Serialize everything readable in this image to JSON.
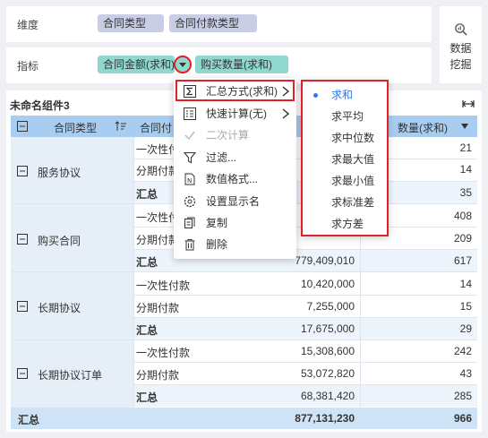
{
  "dimension_row": {
    "label": "维度",
    "chips": [
      "合同类型",
      "合同付款类型"
    ]
  },
  "indicator_row": {
    "label": "指标",
    "chips": [
      "合同金额(求和)",
      "购买数量(求和)"
    ]
  },
  "mining": {
    "label_line1": "数据",
    "label_line2": "挖掘",
    "icon": "data-mining-icon"
  },
  "widget": {
    "title": "未命名组件3",
    "header": {
      "col1": "合同类型",
      "col2": "合同付",
      "col4": "数量(求和)"
    },
    "groups": [
      {
        "name": "服务协议",
        "rows": [
          {
            "sub": "一次性付",
            "amount": "",
            "qty": "21"
          },
          {
            "sub": "分期付款",
            "amount": "",
            "qty": "14"
          },
          {
            "sub": "汇总",
            "amount": "",
            "qty": "35"
          }
        ]
      },
      {
        "name": "购买合同",
        "rows": [
          {
            "sub": "一次性付",
            "amount": "",
            "qty": "408"
          },
          {
            "sub": "分期付款",
            "amount": "",
            "qty": "209"
          },
          {
            "sub": "汇总",
            "amount": "779,409,010",
            "qty": "617"
          }
        ]
      },
      {
        "name": "长期协议",
        "rows": [
          {
            "sub": "一次性付款",
            "amount": "10,420,000",
            "qty": "14"
          },
          {
            "sub": "分期付款",
            "amount": "7,255,000",
            "qty": "15"
          },
          {
            "sub": "汇总",
            "amount": "17,675,000",
            "qty": "29"
          }
        ]
      },
      {
        "name": "长期协议订单",
        "rows": [
          {
            "sub": "一次性付款",
            "amount": "15,308,600",
            "qty": "242"
          },
          {
            "sub": "分期付款",
            "amount": "53,072,820",
            "qty": "43"
          },
          {
            "sub": "汇总",
            "amount": "68,381,420",
            "qty": "285"
          }
        ]
      }
    ],
    "grand_total": {
      "label": "汇总",
      "amount": "877,131,230",
      "qty": "966"
    }
  },
  "context_menu": {
    "items": [
      {
        "label": "汇总方式(求和)",
        "icon": "sigma-icon",
        "submenu": true
      },
      {
        "label": "快速计算(无)",
        "icon": "quick-calc-icon",
        "submenu": true
      },
      {
        "label": "二次计算",
        "icon": "check-icon",
        "disabled": true
      },
      {
        "label": "过滤...",
        "icon": "filter-icon"
      },
      {
        "label": "数值格式...",
        "icon": "number-format-icon"
      },
      {
        "label": "设置显示名",
        "icon": "gear-icon"
      },
      {
        "label": "复制",
        "icon": "copy-icon"
      },
      {
        "label": "删除",
        "icon": "trash-icon"
      }
    ]
  },
  "aggregation_submenu": {
    "items": [
      "求和",
      "求平均",
      "求中位数",
      "求最大值",
      "求最小值",
      "求标准差",
      "求方差"
    ],
    "selected": "求和"
  },
  "colors": {
    "dimension_chip": "#c9cde6",
    "indicator_chip": "#8fd8cf",
    "table_header": "#a9cdf0",
    "highlight": "#e0202a",
    "accent": "#2f7ae5"
  }
}
